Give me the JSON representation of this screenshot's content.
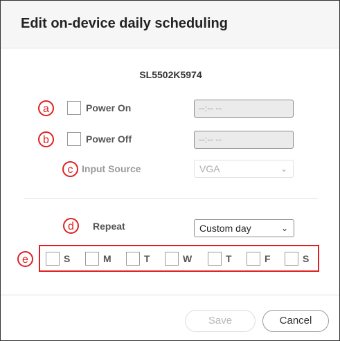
{
  "dialog": {
    "title": "Edit on-device daily scheduling",
    "device_name": "SL5502K5974"
  },
  "power_on": {
    "badge": "a",
    "label": "Power On",
    "time_value": "--:-- --"
  },
  "power_off": {
    "badge": "b",
    "label": "Power Off",
    "time_value": "--:-- --"
  },
  "input_source": {
    "badge": "c",
    "label": "Input Source",
    "selected": "VGA"
  },
  "repeat": {
    "badge": "d",
    "label": "Repeat",
    "selected": "Custom day"
  },
  "days": {
    "badge": "e",
    "items": [
      {
        "label": "S"
      },
      {
        "label": "M"
      },
      {
        "label": "T"
      },
      {
        "label": "W"
      },
      {
        "label": "T"
      },
      {
        "label": "F"
      },
      {
        "label": "S"
      }
    ]
  },
  "buttons": {
    "save": "Save",
    "cancel": "Cancel"
  },
  "icons": {
    "chevron": "chevron-down-icon"
  },
  "colors": {
    "annotation_red": "#e02020",
    "header_bg": "#f6f6f6"
  }
}
